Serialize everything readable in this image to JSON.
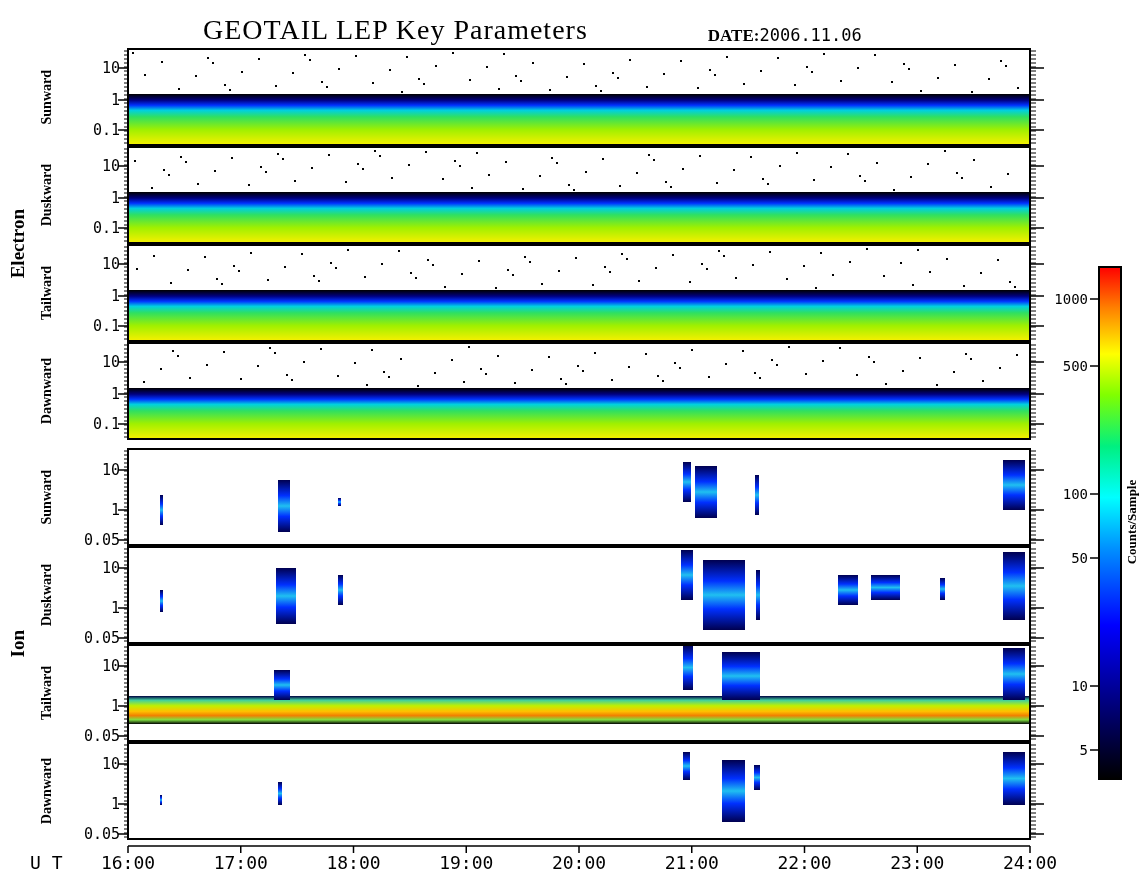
{
  "title": "GEOTAIL LEP Key Parameters",
  "date": {
    "label": "DATE:",
    "value": "2006.11.06"
  },
  "groups": [
    {
      "label": "Electron",
      "panels": [
        {
          "label": "Sunward",
          "kind": "band",
          "yticks": [
            "10",
            "1",
            "0.1"
          ]
        },
        {
          "label": "Duskward",
          "kind": "band",
          "yticks": [
            "10",
            "1",
            "0.1"
          ]
        },
        {
          "label": "Tailward",
          "kind": "band",
          "yticks": [
            "10",
            "1",
            "0.1"
          ]
        },
        {
          "label": "Dawnward",
          "kind": "band",
          "yticks": [
            "10",
            "1",
            "0.1"
          ]
        }
      ]
    },
    {
      "label": "Ion",
      "panels": [
        {
          "label": "Sunward",
          "kind": "patches",
          "yticks": [
            "10",
            "1",
            "0.05"
          ]
        },
        {
          "label": "Duskward",
          "kind": "patches",
          "yticks": [
            "10",
            "1",
            "0.05"
          ]
        },
        {
          "label": "Tailward",
          "kind": "low_band",
          "yticks": [
            "10",
            "1",
            "0.05"
          ]
        },
        {
          "label": "Dawnward",
          "kind": "patches",
          "yticks": [
            "10",
            "1",
            "0.05"
          ]
        }
      ]
    }
  ],
  "x_axis": {
    "label": "U T",
    "ticks": [
      "16:00",
      "17:00",
      "18:00",
      "19:00",
      "20:00",
      "21:00",
      "22:00",
      "23:00",
      "24:00"
    ]
  },
  "colorbar": {
    "label": "Counts/Sample",
    "ticks": [
      "1000",
      "500",
      "100",
      "50",
      "10",
      "5"
    ]
  }
}
